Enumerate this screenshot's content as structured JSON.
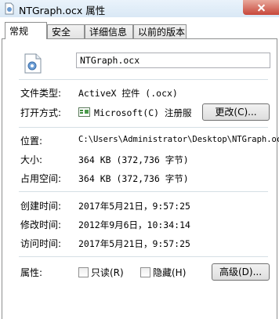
{
  "window": {
    "title": "NTGraph.ocx 属性"
  },
  "tabs": [
    {
      "label": "常规"
    },
    {
      "label": "安全"
    },
    {
      "label": "详细信息"
    },
    {
      "label": "以前的版本"
    }
  ],
  "general": {
    "file_name": "NTGraph.ocx",
    "type_label": "文件类型:",
    "type_value": "ActiveX 控件 (.ocx)",
    "opens_with_label": "打开方式:",
    "opens_with_value": "Microsoft(C) 注册服",
    "change_button": "更改(C)...",
    "location_label": "位置:",
    "location_value": "C:\\Users\\Administrator\\Desktop\\NTGraph.oc",
    "size_label": "大小:",
    "size_value": "364 KB (372,736 字节)",
    "disk_size_label": "占用空间:",
    "disk_size_value": "364 KB (372,736 字节)",
    "created_label": "创建时间:",
    "created_value": "2017年5月21日，9:57:25",
    "modified_label": "修改时间:",
    "modified_value": "2012年9月6日，10:34:14",
    "accessed_label": "访问时间:",
    "accessed_value": "2017年5月21日，9:57:25",
    "attributes_label": "属性:",
    "readonly_label": "只读(R)",
    "hidden_label": "隐藏(H)",
    "advanced_button": "高级(D)..."
  }
}
